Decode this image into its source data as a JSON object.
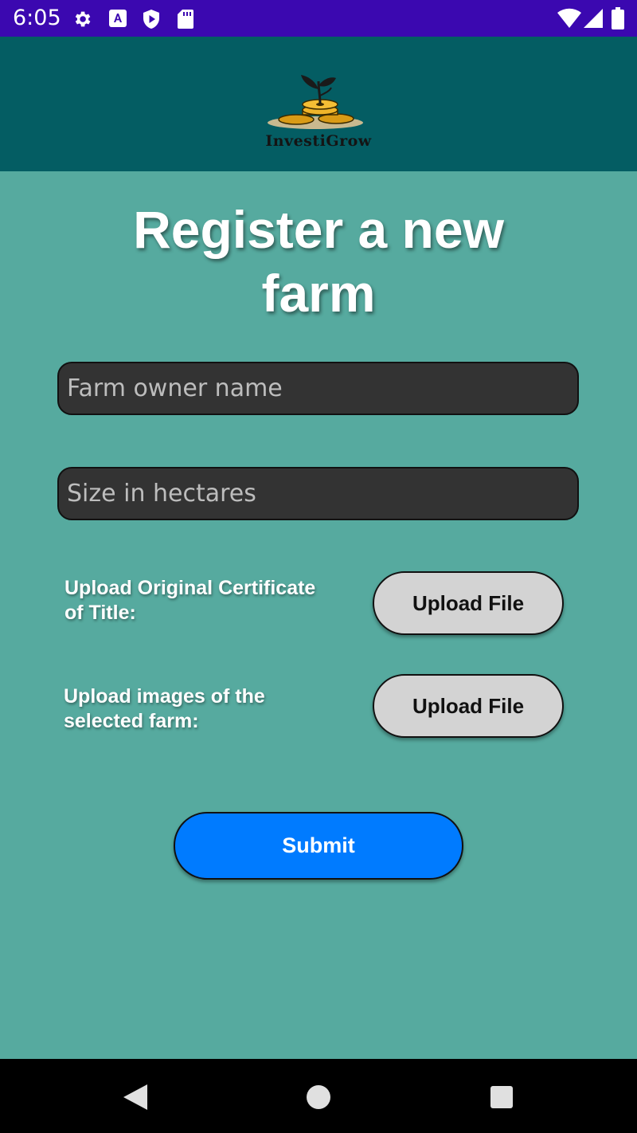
{
  "status_bar": {
    "time": "6:05",
    "icons": [
      "gear-icon",
      "keyboard-a-icon",
      "shield-play-icon",
      "sd-card-icon",
      "wifi-icon",
      "cellular-signal-icon",
      "battery-icon"
    ]
  },
  "header": {
    "logo_text": "InvestiGrow"
  },
  "page": {
    "title": "Register a new farm"
  },
  "form": {
    "owner_placeholder": "Farm owner name",
    "size_placeholder": "Size in hectares",
    "certificate_label": "Upload Original Certificate of Title:",
    "certificate_button": "Upload File",
    "images_label": "Upload images of the selected farm:",
    "images_button": "Upload File",
    "submit_label": "Submit"
  },
  "nav_bar": {
    "icons": [
      "back-icon",
      "home-icon",
      "recents-icon"
    ]
  },
  "colors": {
    "status_bar": "#3b08b0",
    "header": "#045d63",
    "background": "#56aa9f",
    "input_bg": "#333333",
    "upload_button": "#d3d3d3",
    "submit_button": "#007bff"
  }
}
